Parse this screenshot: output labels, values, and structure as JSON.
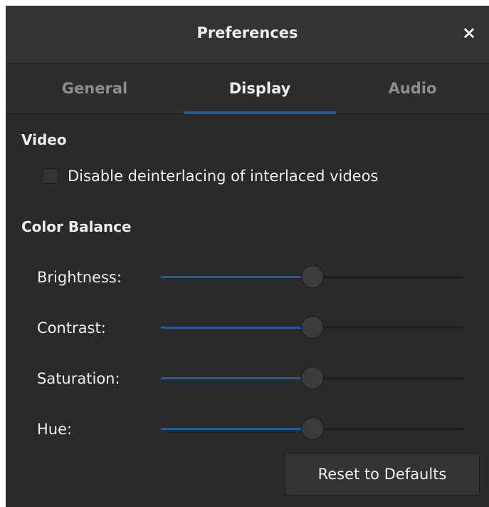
{
  "window": {
    "title": "Preferences",
    "close_glyph": "×"
  },
  "tabs": [
    {
      "label": "General",
      "active": false
    },
    {
      "label": "Display",
      "active": true
    },
    {
      "label": "Audio",
      "active": false
    }
  ],
  "video": {
    "heading": "Video",
    "deinterlace_label": "Disable deinterlacing of interlaced videos",
    "deinterlace_checked": false
  },
  "color_balance": {
    "heading": "Color Balance",
    "sliders": [
      {
        "label": "Brightness:",
        "value": 0.5
      },
      {
        "label": "Contrast:",
        "value": 0.5
      },
      {
        "label": "Saturation:",
        "value": 0.5
      },
      {
        "label": "Hue:",
        "value": 0.5
      }
    ]
  },
  "reset_label": "Reset to Defaults",
  "colors": {
    "accent": "#215d9c",
    "background": "#2a2a2a",
    "header": "#333333",
    "text": "#eeeeec",
    "inactive_tab_text": "#8b8e8f"
  }
}
